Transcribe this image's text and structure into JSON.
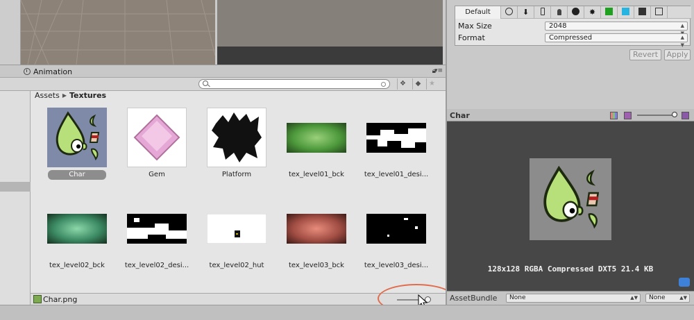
{
  "project": {
    "tab_label": "Animation",
    "breadcrumb_root": "Assets",
    "breadcrumb_current": "Textures",
    "assets": [
      {
        "name": "Char",
        "selected": true
      },
      {
        "name": "Gem"
      },
      {
        "name": "Platform"
      },
      {
        "name": "tex_level01_bck"
      },
      {
        "name": "tex_level01_desi..."
      },
      {
        "name": "tex_level02_bck"
      },
      {
        "name": "tex_level02_desi..."
      },
      {
        "name": "tex_level02_hut"
      },
      {
        "name": "tex_level03_bck"
      },
      {
        "name": "tex_level03_desi..."
      }
    ],
    "selected_file": "Char.png",
    "thumbnail_size_fraction": 0.85
  },
  "import_settings": {
    "default_tab": "Default",
    "max_size_label": "Max Size",
    "max_size_value": "2048",
    "format_label": "Format",
    "format_value": "Compressed",
    "revert_label": "Revert",
    "apply_label": "Apply"
  },
  "preview": {
    "title": "Char",
    "info": "128x128  RGBA Compressed DXT5   21.4 KB",
    "asset_bundle_label": "AssetBundle",
    "asset_bundle_value": "None",
    "asset_bundle_variant": "None"
  },
  "colors": {
    "highlight_ellipse": "#e06d4e",
    "selection": "#8d8d8d",
    "preview_bg": "#474747"
  }
}
